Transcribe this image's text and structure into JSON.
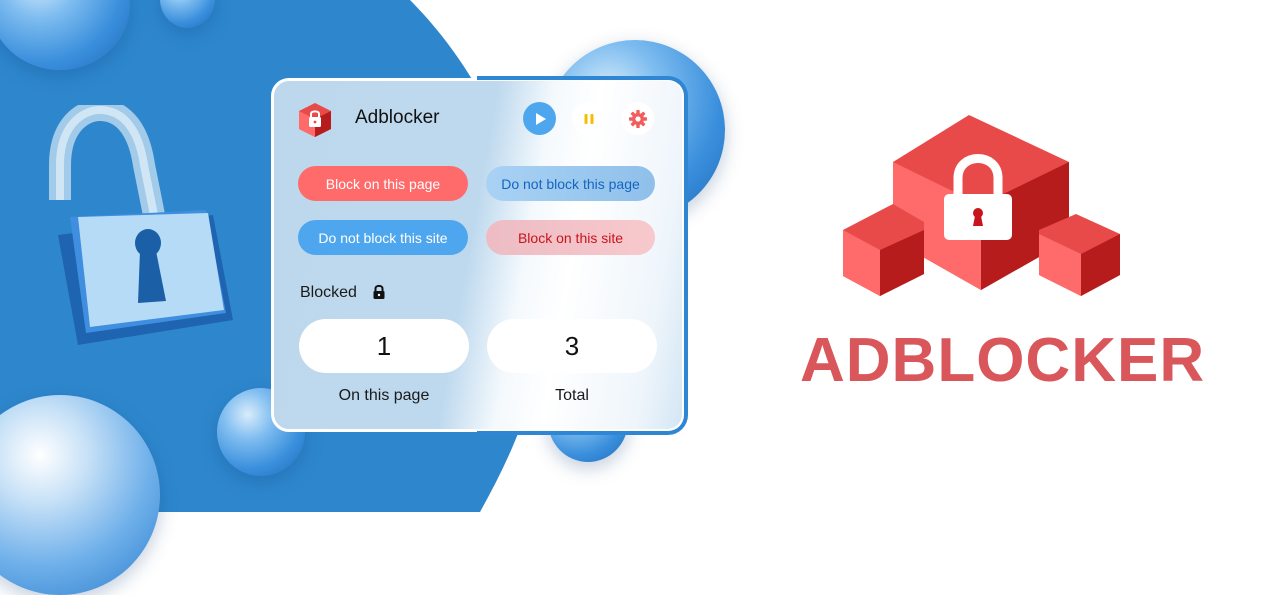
{
  "popup": {
    "app_title": "Adblocker",
    "icons": {
      "logo": "red-cube-lock-icon",
      "play": "play-icon",
      "pause": "pause-icon",
      "settings": "gear-icon"
    },
    "buttons": [
      {
        "label": "Block on this page",
        "style": "primary-red"
      },
      {
        "label": "Do not block this page",
        "style": "light-blue"
      },
      {
        "label": "Do not block this site",
        "style": "primary-blue"
      },
      {
        "label": "Block on this site",
        "style": "light-red"
      }
    ],
    "blocked_label": "Blocked",
    "stats": [
      {
        "value": "1",
        "label": "On this page"
      },
      {
        "value": "3",
        "label": "Total"
      }
    ]
  },
  "brand": {
    "name": "ADBLOCKER"
  },
  "colors": {
    "accent_blue": "#2f86d2",
    "button_red": "#ff6b6b",
    "button_blue": "#4ea7ee",
    "light_red_bg": "#f4c3c7",
    "light_red_text": "#c8141d",
    "light_blue_bg": "#9ccaef",
    "light_blue_text": "#1565c0",
    "pause_yellow": "#f5bd00",
    "gear_red": "#f25c5c",
    "brand_red": "#d9575a"
  }
}
